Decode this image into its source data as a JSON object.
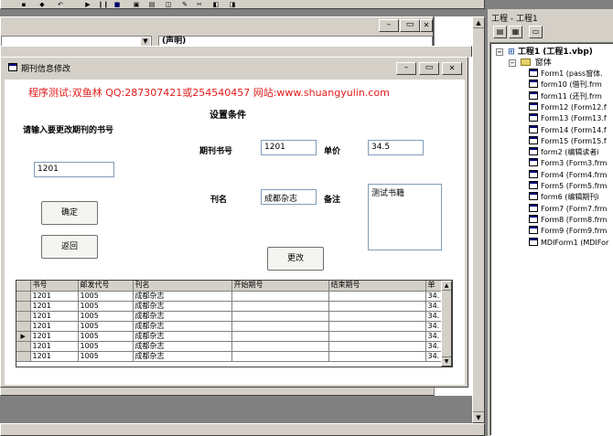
{
  "designer_dropdown": {
    "right_value": "(声明)"
  },
  "project_panel": {
    "title": "工程 - 工程1",
    "root": "工程1 (工程1.vbp)",
    "folder": "窗体",
    "items": [
      "Form1 (pass窗体.",
      "form10 (借刊.frm",
      "form11 (还刊.frm",
      "Form12 (Form12.f",
      "Form13 (Form13.f",
      "Form14 (Form14.f",
      "Form15 (Form15.f",
      "form2 (编辑读者i",
      "Form3 (Form3.frm",
      "Form4 (Form4.frm",
      "Form5 (Form5.frm",
      "form6 (编辑期刊i",
      "Form7 (Form7.frm",
      "Form8 (Form8.frm",
      "Form9 (Form9.frm",
      "MDIForm1 (MDIFor"
    ]
  },
  "form": {
    "title": "期刊信息修改",
    "banner": "程序测试:双鱼林 QQ:287307421或254540457 网站:www.shuangyulin.com",
    "section_title": "设置条件",
    "prompt": "请输入要更改期刊的书号",
    "book_id_input": "1201",
    "confirm_btn": "确定",
    "back_btn": "返回",
    "issue_no_label": "期刊书号",
    "issue_no_value": "1201",
    "price_label": "单价",
    "price_value": "34.5",
    "name_label": "刊名",
    "name_value": "成都杂志",
    "remark_label": "备注",
    "remark_value": "测试书籍",
    "update_btn": "更改"
  },
  "grid": {
    "columns": [
      "书号",
      "邮发代号",
      "刊名",
      "开始期号",
      "结束期号",
      "单"
    ],
    "rows": [
      [
        "1201",
        "1005",
        "成都杂志",
        "",
        "",
        "34."
      ],
      [
        "1201",
        "1005",
        "成都杂志",
        "",
        "",
        "34."
      ],
      [
        "1201",
        "1005",
        "成都杂志",
        "",
        "",
        "34."
      ],
      [
        "1201",
        "1005",
        "成都杂志",
        "",
        "",
        "34."
      ],
      [
        "1201",
        "1005",
        "成都杂志",
        "",
        "",
        "34."
      ],
      [
        "1201",
        "1005",
        "成都杂志",
        "",
        "",
        "34."
      ],
      [
        "1201",
        "1005",
        "成都杂志",
        "",
        "",
        "34."
      ]
    ]
  },
  "colors": {
    "banner": "#e21b1b",
    "title_active": "#d4d0c8",
    "face": "#d4d0c8"
  },
  "icons": [
    "form-icon",
    "minimize-icon",
    "restore-icon",
    "close-icon",
    "folder-icon",
    "project-icon",
    "scroll-up-icon",
    "scroll-down-icon",
    "row-selector-icon"
  ]
}
